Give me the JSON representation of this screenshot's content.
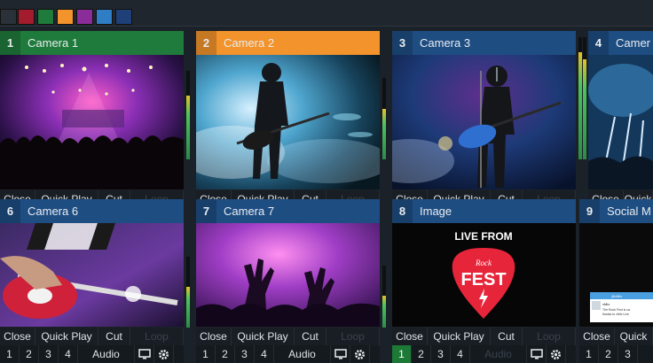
{
  "colors": {
    "swatches": [
      "#2b3138",
      "#a21c2d",
      "#1f7b3b",
      "#f3932b",
      "#8a2c9a",
      "#2f7dc4",
      "#1e3f78"
    ],
    "program_green": "#1f7b3b",
    "preview_orange": "#f3932b",
    "input_blue": "#1e4d82"
  },
  "inputs": [
    {
      "number": "1",
      "title": "Camera 1",
      "state": "program",
      "image": "concert-crowd",
      "audio_on": true,
      "vu": 0.72
    },
    {
      "number": "2",
      "title": "Camera 2",
      "state": "preview",
      "image": "guitarist-smoke",
      "audio_on": false,
      "vu": 0.62
    },
    {
      "number": "3",
      "title": "Camera 3",
      "state": "normal",
      "image": "singer-guitar",
      "audio_on": true,
      "vu": 0.88
    },
    {
      "number": "4",
      "title": "Camer",
      "state": "normal",
      "image": "crowd-partial",
      "audio_on": false,
      "vu": 0.0
    },
    {
      "number": "6",
      "title": "Camera 6",
      "state": "normal",
      "image": "guitar-closeup",
      "audio_on": false,
      "vu": 0.58
    },
    {
      "number": "7",
      "title": "Camera 7",
      "state": "normal",
      "image": "hands-silhouette",
      "audio_on": false,
      "vu": 0.52
    },
    {
      "number": "8",
      "title": "Image",
      "state": "normal",
      "image": "rock-fest-logo",
      "audio_on": false,
      "vu": 0.0
    },
    {
      "number": "9",
      "title": "Social M",
      "state": "normal",
      "image": "social-feed",
      "audio_on": false,
      "vu": 0.0
    }
  ],
  "buttons": {
    "close": "Close",
    "quick_play": "Quick Play",
    "cut": "Cut",
    "loop": "Loop",
    "overlay_1": "1",
    "overlay_2": "2",
    "overlay_3": "3",
    "overlay_4": "4",
    "audio": "Audio",
    "quick_trunc": "Quick",
    "monitor_icon": "monitor-icon",
    "settings_icon": "gear-icon"
  },
  "rockfest": {
    "line1": "LIVE FROM",
    "line2": "Rock",
    "line3": "FEST"
  },
  "social": {
    "handle": "@vMix",
    "text1": "vMix",
    "text2": "The Rock Fest is ca",
    "text3": "thanks to vMix Live"
  },
  "overlay_button_8_active": true
}
